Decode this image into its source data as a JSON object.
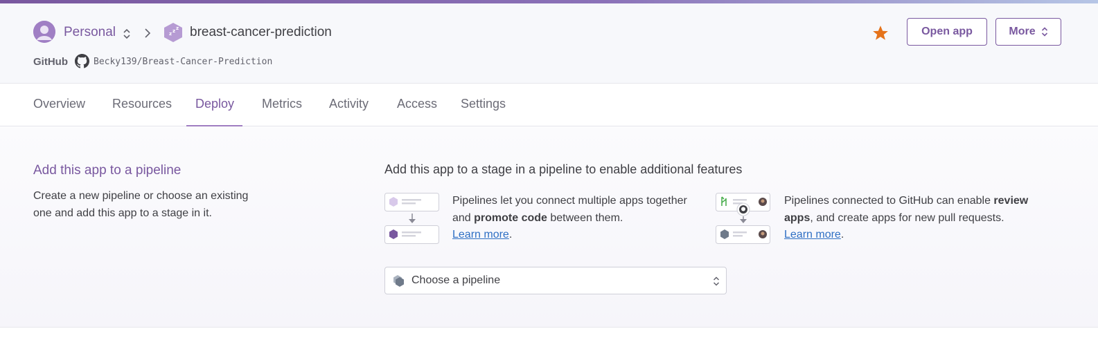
{
  "header": {
    "account_name": "Personal",
    "app_name": "breast-cancer-prediction",
    "github_label": "GitHub",
    "github_repo": "Becky139/Breast-Cancer-Prediction",
    "open_app_label": "Open app",
    "more_label": "More",
    "accent_color": "#79589f",
    "star_color": "#e5731a"
  },
  "tabs": [
    {
      "label": "Overview",
      "active": false
    },
    {
      "label": "Resources",
      "active": false
    },
    {
      "label": "Deploy",
      "active": true
    },
    {
      "label": "Metrics",
      "active": false
    },
    {
      "label": "Activity",
      "active": false
    },
    {
      "label": "Access",
      "active": false
    },
    {
      "label": "Settings",
      "active": false
    }
  ],
  "pipeline_section": {
    "title": "Add this app to a pipeline",
    "description": "Create a new pipeline or choose an existing one and add this app to a stage in it.",
    "features_heading": "Add this app to a stage in a pipeline to enable additional features",
    "feature_1": {
      "text_before": "Pipelines let you connect multiple apps together and ",
      "bold": "promote code",
      "text_after": " between them.",
      "link": "Learn more",
      "period": "."
    },
    "feature_2": {
      "text_before": "Pipelines connected to GitHub can enable ",
      "bold": "review apps",
      "text_after": ", and create apps for new pull requests.",
      "link": "Learn more",
      "period": "."
    },
    "select_placeholder": "Choose a pipeline"
  },
  "icons": {
    "avatar": "user-avatar-icon",
    "switch": "up-down-chevron-icon",
    "breadcrumb": "chevron-right-icon",
    "app": "sleeping-app-hexagon-icon",
    "github": "github-icon",
    "star": "star-icon",
    "pipeline": "pipeline-icon"
  }
}
